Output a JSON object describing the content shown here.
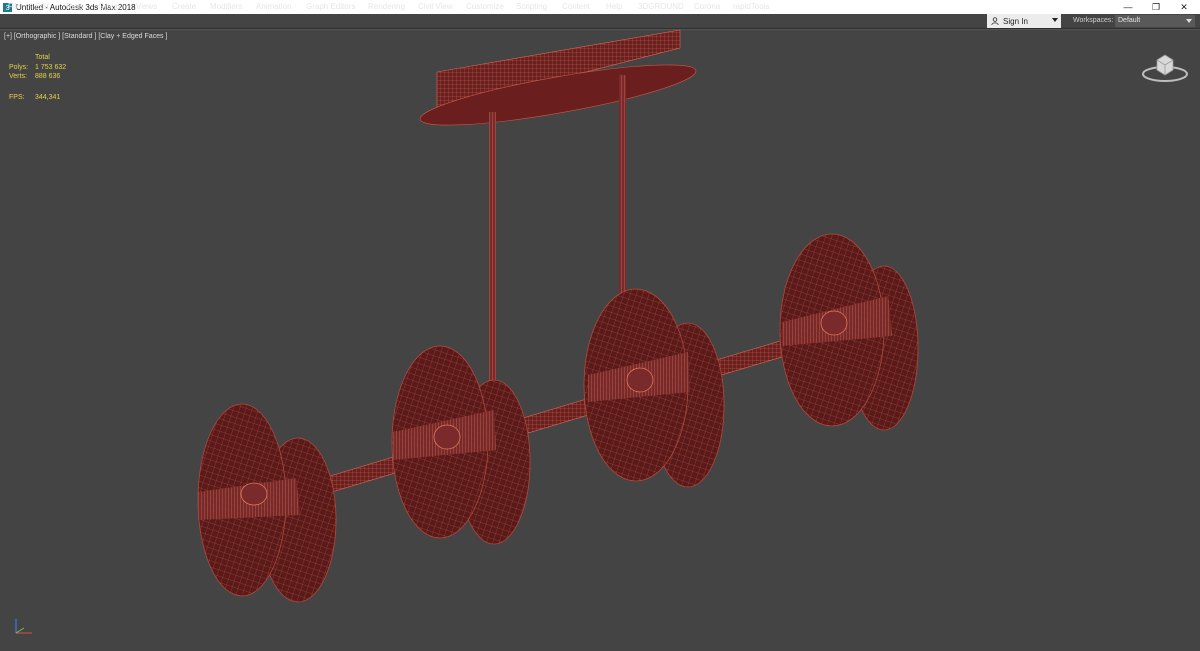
{
  "window": {
    "title": "Untitled - Autodesk 3ds Max 2018",
    "minimize": "—",
    "restore": "❐",
    "close": "✕"
  },
  "menu": [
    "File",
    "Edit",
    "Tools",
    "Group",
    "Views",
    "Create",
    "Modifiers",
    "Animation",
    "Graph Editors",
    "Rendering",
    "Civil View",
    "Customize",
    "Scripting",
    "Content",
    "Help",
    "3DGROUND",
    "Corona",
    "rapidTools"
  ],
  "signin": {
    "label": "Sign In"
  },
  "workspaces": {
    "label": "Workspaces:",
    "value": "Default"
  },
  "viewport": {
    "label": "[+] [Orthographic ] [Standard ] [Clay + Edged Faces ]",
    "stats": {
      "header": "Total",
      "polys_label": "Polys:",
      "polys_value": "1 753 632",
      "verts_label": "Verts:",
      "verts_value": "888 636",
      "fps_label": "FPS:",
      "fps_value": "344,341"
    }
  },
  "colors": {
    "accent": "#7a2a2a",
    "wire": "#d86a55",
    "bg": "#444444",
    "stats": "#e6d24a"
  },
  "icons": {
    "app": "3ds-max-icon",
    "user": "user-icon",
    "viewcube": "viewcube-icon",
    "axis": "axis-tripod-icon"
  }
}
